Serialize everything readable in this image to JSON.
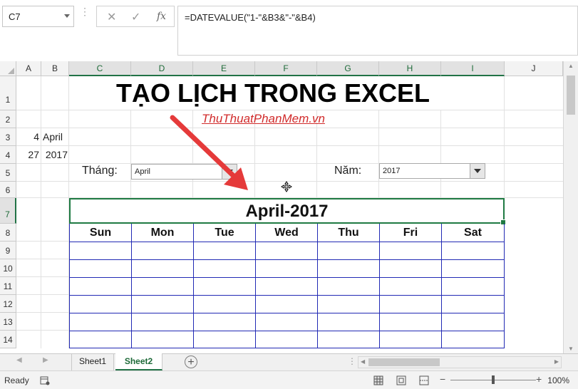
{
  "formula_bar": {
    "name_box": "C7",
    "fx_label": "fx",
    "cancel_glyph": "✕",
    "confirm_glyph": "✓",
    "formula": "=DATEVALUE(\"1-\"&B3&\"-\"&B4)"
  },
  "columns": [
    "A",
    "B",
    "C",
    "D",
    "E",
    "F",
    "G",
    "H",
    "I",
    "J"
  ],
  "rows": [
    "1",
    "2",
    "3",
    "4",
    "5",
    "6",
    "7",
    "8",
    "9",
    "10",
    "11",
    "12",
    "13",
    "14"
  ],
  "cells": {
    "A3": "4",
    "B3": "April",
    "A4": "27",
    "B4": "2017",
    "month_label": "Tháng:",
    "year_label": "Năm:"
  },
  "title": "TẠO LỊCH TRONG EXCEL",
  "subtitle": "ThuThuatPhanMem.vn",
  "month_combo": {
    "value": "April"
  },
  "year_combo": {
    "value": "2017"
  },
  "calendar": {
    "header": "April-2017",
    "days": [
      "Sun",
      "Mon",
      "Tue",
      "Wed",
      "Thu",
      "Fri",
      "Sat"
    ],
    "border_color": "#2129b4"
  },
  "annotation_arrow_color": "#e53a3a",
  "sheets": [
    {
      "label": "Sheet1",
      "active": false
    },
    {
      "label": "Sheet2",
      "active": true
    }
  ],
  "status": {
    "ready": "Ready",
    "zoom": "100%"
  },
  "accent": "#217346"
}
